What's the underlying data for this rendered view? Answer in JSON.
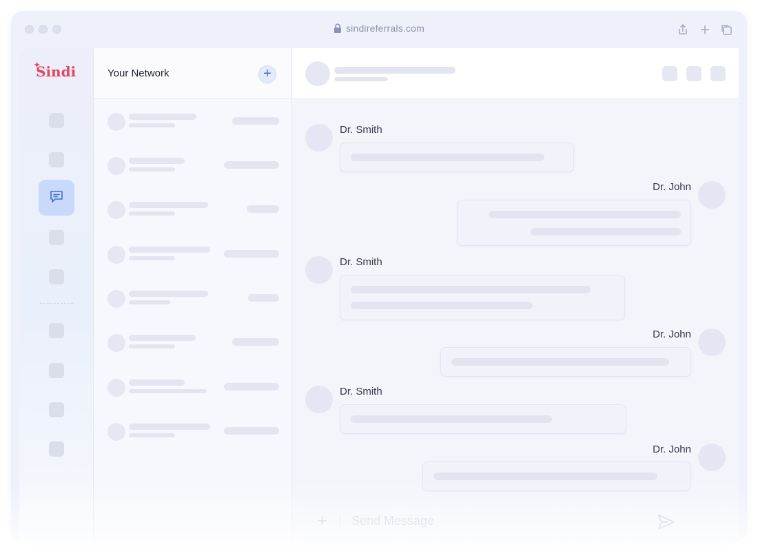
{
  "browser": {
    "url": "sindireferrals.com",
    "icons": [
      "lock-icon",
      "share-icon",
      "new-tab-icon",
      "tabs-icon"
    ]
  },
  "brand": {
    "name": "Sindi",
    "color": "#e0475e",
    "accent": "#3d6fd8"
  },
  "sidebar": {
    "active_item_icon": "chat-icon"
  },
  "network": {
    "title": "Your Network",
    "add_label": "+"
  },
  "chat": {
    "messages": [
      {
        "sender": "Dr. Smith",
        "side": "left"
      },
      {
        "sender": "Dr. John",
        "side": "right"
      },
      {
        "sender": "Dr. Smith",
        "side": "left"
      },
      {
        "sender": "Dr. John",
        "side": "right"
      },
      {
        "sender": "Dr. Smith",
        "side": "left"
      },
      {
        "sender": "Dr. John",
        "side": "right"
      }
    ],
    "composer": {
      "plus_label": "+",
      "placeholder": "Send Message"
    }
  }
}
